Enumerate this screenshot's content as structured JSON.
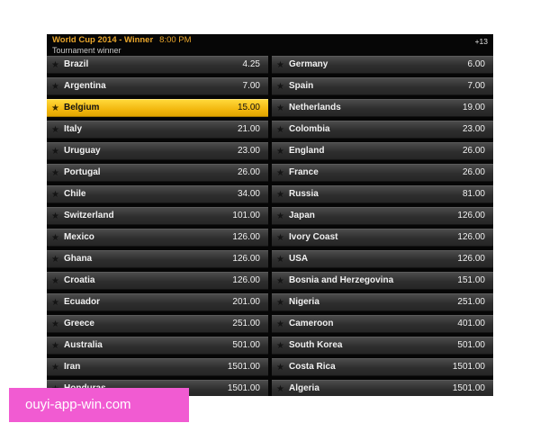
{
  "header": {
    "title": "World Cup 2014 - Winner",
    "time": "8:00 PM",
    "subtitle": "Tournament winner",
    "more_markets": "+13"
  },
  "selected_team": "Belgium",
  "left_column": [
    {
      "team": "Brazil",
      "odds": "4.25"
    },
    {
      "team": "Argentina",
      "odds": "7.00"
    },
    {
      "team": "Belgium",
      "odds": "15.00"
    },
    {
      "team": "Italy",
      "odds": "21.00"
    },
    {
      "team": "Uruguay",
      "odds": "23.00"
    },
    {
      "team": "Portugal",
      "odds": "26.00"
    },
    {
      "team": "Chile",
      "odds": "34.00"
    },
    {
      "team": "Switzerland",
      "odds": "101.00"
    },
    {
      "team": "Mexico",
      "odds": "126.00"
    },
    {
      "team": "Ghana",
      "odds": "126.00"
    },
    {
      "team": "Croatia",
      "odds": "126.00"
    },
    {
      "team": "Ecuador",
      "odds": "201.00"
    },
    {
      "team": "Greece",
      "odds": "251.00"
    },
    {
      "team": "Australia",
      "odds": "501.00"
    },
    {
      "team": "Iran",
      "odds": "1501.00"
    },
    {
      "team": "Honduras",
      "odds": "1501.00"
    }
  ],
  "right_column": [
    {
      "team": "Germany",
      "odds": "6.00"
    },
    {
      "team": "Spain",
      "odds": "7.00"
    },
    {
      "team": "Netherlands",
      "odds": "19.00"
    },
    {
      "team": "Colombia",
      "odds": "23.00"
    },
    {
      "team": "England",
      "odds": "26.00"
    },
    {
      "team": "France",
      "odds": "26.00"
    },
    {
      "team": "Russia",
      "odds": "81.00"
    },
    {
      "team": "Japan",
      "odds": "126.00"
    },
    {
      "team": "Ivory Coast",
      "odds": "126.00"
    },
    {
      "team": "USA",
      "odds": "126.00"
    },
    {
      "team": "Bosnia and Herzegovina",
      "odds": "151.00"
    },
    {
      "team": "Nigeria",
      "odds": "251.00"
    },
    {
      "team": "Cameroon",
      "odds": "401.00"
    },
    {
      "team": "South Korea",
      "odds": "501.00"
    },
    {
      "team": "Costa Rica",
      "odds": "1501.00"
    },
    {
      "team": "Algeria",
      "odds": "1501.00"
    }
  ],
  "star_icon": "star-icon",
  "watermark": "ouyi-app-win.com",
  "colors": {
    "accent": "#e9a62c",
    "selected": "#f2b70e",
    "row": "#3a3a3a",
    "watermark_bg": "#f15bd2"
  }
}
